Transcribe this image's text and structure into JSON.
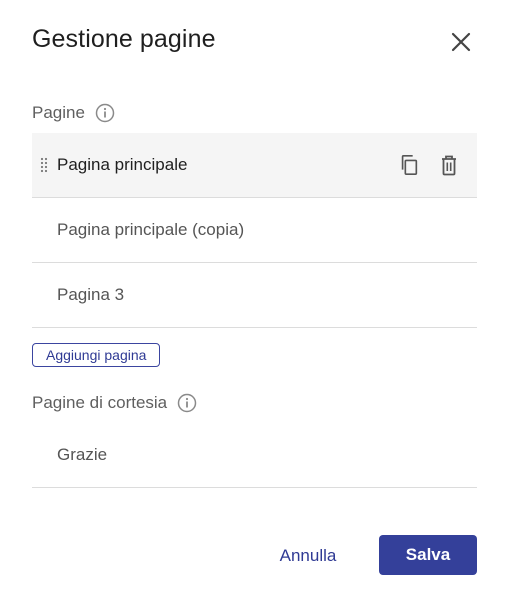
{
  "dialog": {
    "title": "Gestione pagine",
    "close_icon": "close-icon"
  },
  "pages_section": {
    "label": "Pagine",
    "info_icon": "info-icon",
    "items": [
      {
        "label": "Pagina principale",
        "active": true
      },
      {
        "label": "Pagina principale (copia)",
        "active": false
      },
      {
        "label": "Pagina 3",
        "active": false
      }
    ],
    "row_actions": [
      "copy-icon",
      "trash-icon"
    ],
    "add_label": "Aggiungi pagina"
  },
  "courtesy_section": {
    "label": "Pagine di cortesia",
    "info_icon": "info-icon",
    "items": [
      {
        "label": "Grazie"
      }
    ]
  },
  "footer": {
    "cancel_label": "Annulla",
    "save_label": "Salva"
  },
  "colors": {
    "accent": "#34409a",
    "active_row_bg": "#f5f5f5",
    "divider": "#dcdcdc"
  }
}
